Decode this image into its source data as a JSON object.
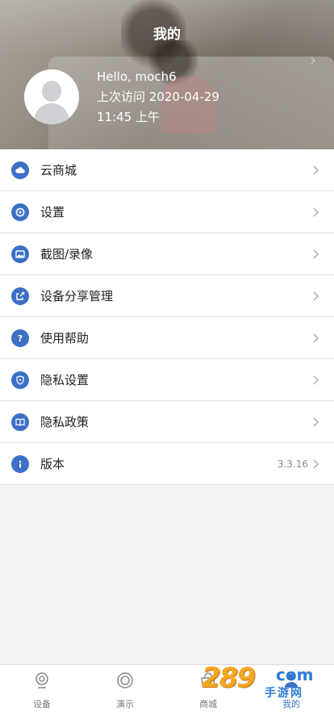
{
  "header": {
    "title": "我的",
    "greeting": "Hello, moch6",
    "last_visit": "上次访问 2020-04-29",
    "last_visit_time": "11:45 上午"
  },
  "menu": [
    {
      "label": "云商城",
      "icon": "cloud-icon"
    },
    {
      "label": "设置",
      "icon": "gear-icon"
    },
    {
      "label": "截图/录像",
      "icon": "image-icon"
    },
    {
      "label": "设备分享管理",
      "icon": "share-icon"
    },
    {
      "label": "使用帮助",
      "icon": "help-icon"
    },
    {
      "label": "隐私设置",
      "icon": "shield-icon"
    },
    {
      "label": "隐私政策",
      "icon": "book-icon"
    },
    {
      "label": "版本",
      "icon": "info-icon",
      "value": "3.3.16"
    }
  ],
  "tabbar": [
    {
      "label": "设备",
      "icon": "camera-icon"
    },
    {
      "label": "演示",
      "icon": "demo-icon"
    },
    {
      "label": "商城",
      "icon": "store-icon"
    },
    {
      "label": "我的",
      "icon": "user-icon",
      "active": true
    }
  ],
  "watermark": {
    "num": "289",
    "com": "com",
    "cn": "手游网"
  },
  "colors": {
    "accent": "#3d6fc4",
    "background": "#f2f2f4",
    "divider": "#e3e3e6"
  }
}
